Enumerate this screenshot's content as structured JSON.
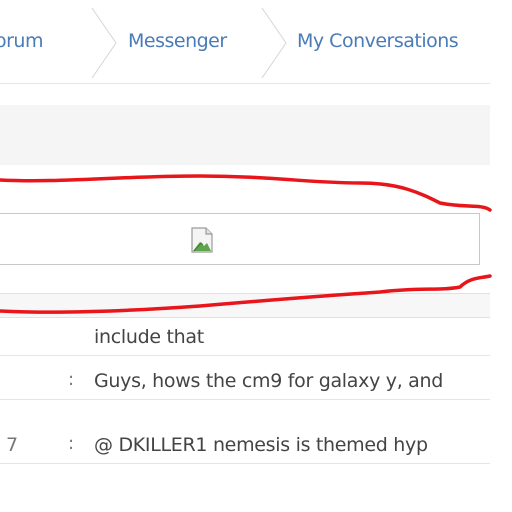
{
  "colors": {
    "link": "#4a7bb7",
    "separator": "#d6d6d6",
    "gray_band": "#f5f5f5",
    "row_border": "#e6e6e6",
    "annotation": "#e8151b"
  },
  "breadcrumb": {
    "items": [
      {
        "label": "orum"
      },
      {
        "label": "Messenger"
      },
      {
        "label": "My Conversations"
      }
    ]
  },
  "image_placeholder": {
    "icon": "broken-image-icon"
  },
  "shoutbox": {
    "rows": [
      {
        "time": "",
        "colon": "",
        "message": "include that"
      },
      {
        "time": "",
        "colon": ":",
        "message": "Guys, hows the cm9 for galaxy y, and"
      },
      {
        "time": "7",
        "colon": ":",
        "message": "@ DKILLER1 nemesis is themed hyp"
      }
    ]
  },
  "annotation": {
    "shape": "red-freehand-outline"
  }
}
